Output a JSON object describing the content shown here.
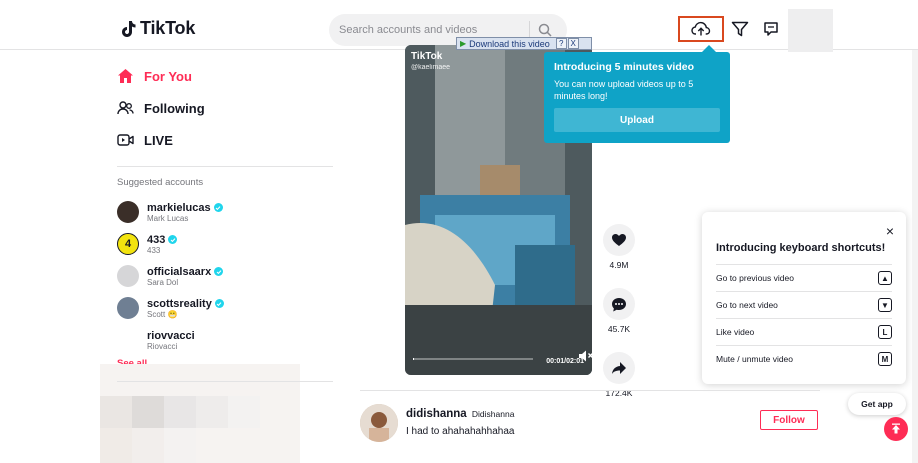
{
  "header": {
    "logo_text": "TikTok",
    "search_placeholder": "Search accounts and videos"
  },
  "sidebar": {
    "nav": [
      {
        "label": "For You",
        "icon": "home-icon",
        "active": true
      },
      {
        "label": "Following",
        "icon": "users-icon",
        "active": false
      },
      {
        "label": "LIVE",
        "icon": "live-icon",
        "active": false
      }
    ],
    "suggested_title": "Suggested accounts",
    "accounts": [
      {
        "username": "markielucas",
        "name": "Mark Lucas",
        "verified": true,
        "avatar_color": "#3a2e28"
      },
      {
        "username": "433",
        "name": "433",
        "verified": true,
        "avatar_color": "#f2e30f"
      },
      {
        "username": "officialsaarx",
        "name": "Sara Dol",
        "verified": true,
        "avatar_color": "#d6d6d8"
      },
      {
        "username": "scottsreality",
        "name": "Scott 😬",
        "verified": true,
        "avatar_color": "#6f7f93"
      },
      {
        "username": "riovvacci",
        "name": "Riovacci",
        "verified": false,
        "avatar_color": "#ffffff"
      }
    ],
    "see_all": "See all"
  },
  "download_bar": {
    "label": "Download this video",
    "help": "?",
    "close": "X"
  },
  "video": {
    "logo": "TikTok",
    "handle": "@kaelimaee",
    "time": "00:01/02:01",
    "progress": 0.008
  },
  "actions": [
    {
      "icon": "heart-icon",
      "count": "4.9M"
    },
    {
      "icon": "comment-icon",
      "count": "45.7K"
    },
    {
      "icon": "share-icon",
      "count": "172.4K"
    }
  ],
  "upload_popup": {
    "title": "Introducing 5 minutes video",
    "body": "You can now upload videos up to 5 minutes long!",
    "button": "Upload"
  },
  "shortcuts": {
    "close": "×",
    "title": "Introducing keyboard shortcuts!",
    "rows": [
      {
        "label": "Go to previous video",
        "key": "▲"
      },
      {
        "label": "Go to next video",
        "key": "▼"
      },
      {
        "label": "Like video",
        "key": "L"
      },
      {
        "label": "Mute / unmute video",
        "key": "M"
      }
    ]
  },
  "get_app": "Get app",
  "post": {
    "username": "didishanna",
    "nickname": "Didishanna",
    "caption": "I had to ahahahahhahaa",
    "follow": "Follow"
  },
  "colors": {
    "brand": "#fe2c55",
    "popup": "#0fa3c7",
    "verified": "#20d5ec"
  }
}
